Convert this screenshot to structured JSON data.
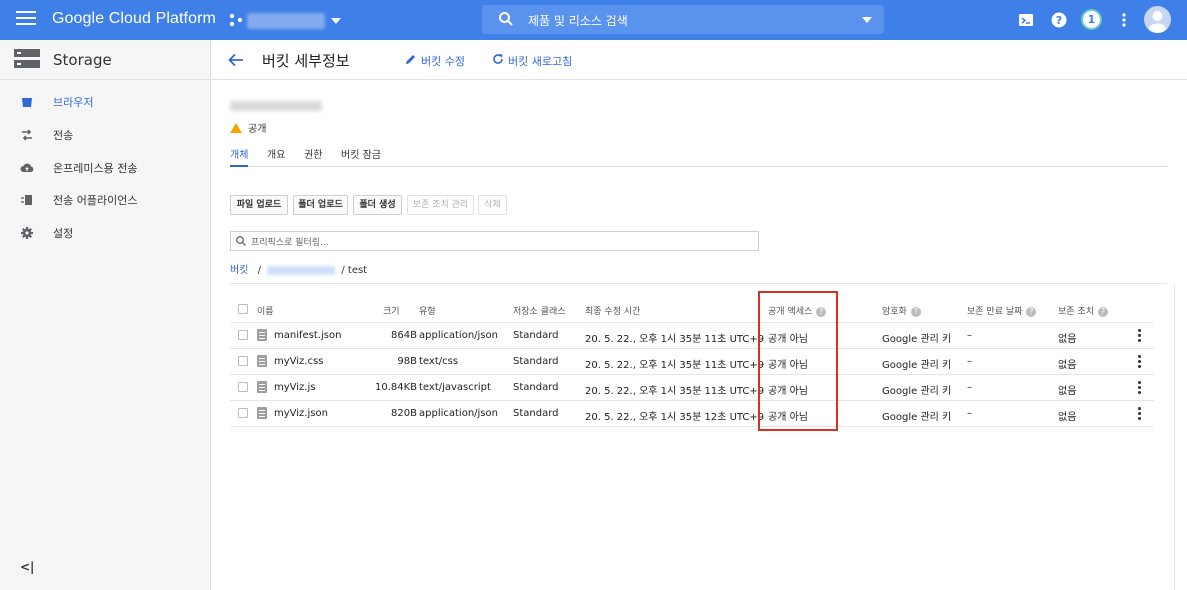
{
  "topbar": {
    "brand": "Google Cloud Platform",
    "search_placeholder": "제품 및 리소스 검색",
    "notification_count": "1"
  },
  "sidebar": {
    "title": "Storage",
    "items": [
      {
        "label": "브라우저",
        "icon": "bucket-icon",
        "active": true
      },
      {
        "label": "전송",
        "icon": "transfer-icon",
        "active": false
      },
      {
        "label": "온프레미스용 전송",
        "icon": "cloud-upload-icon",
        "active": false
      },
      {
        "label": "전송 어플라이언스",
        "icon": "appliance-icon",
        "active": false
      },
      {
        "label": "설정",
        "icon": "gear-icon",
        "active": false
      }
    ],
    "collapse_label": "<|"
  },
  "header": {
    "title": "버킷 세부정보",
    "edit_label": "버킷 수정",
    "refresh_label": "버킷 새로고침"
  },
  "bucket": {
    "access_label": "공개"
  },
  "tabs": [
    "개체",
    "개요",
    "권한",
    "버킷 잠금"
  ],
  "buttons": {
    "upload_files": "파일 업로드",
    "upload_folder": "폴더 업로드",
    "create_folder": "폴더 생성",
    "manage_holds": "보존 조치 관리",
    "delete": "삭제"
  },
  "filter": {
    "placeholder": "프리픽스로 필터링..."
  },
  "breadcrumb": {
    "root": "버킷",
    "sep": "/",
    "folder": "/ test"
  },
  "table": {
    "headers": {
      "name": "이름",
      "size": "크기",
      "type": "유형",
      "storage_class": "저장소 클래스",
      "modified": "최종 수정 시간",
      "public_access": "공개 액세스",
      "encryption": "암호화",
      "retention_expiry": "보존 만료 날짜",
      "hold": "보존 조치"
    },
    "rows": [
      {
        "name": "manifest.json",
        "size": "864B",
        "type": "application/json",
        "storage_class": "Standard",
        "modified": "20. 5. 22., 오후 1시 35분 11초 UTC+9",
        "public_access": "공개 아님",
        "encryption": "Google 관리 키",
        "retention_expiry": "–",
        "hold": "없음"
      },
      {
        "name": "myViz.css",
        "size": "98B",
        "type": "text/css",
        "storage_class": "Standard",
        "modified": "20. 5. 22., 오후 1시 35분 11초 UTC+9",
        "public_access": "공개 아님",
        "encryption": "Google 관리 키",
        "retention_expiry": "–",
        "hold": "없음"
      },
      {
        "name": "myViz.js",
        "size": "10.84KB",
        "type": "text/javascript",
        "storage_class": "Standard",
        "modified": "20. 5. 22., 오후 1시 35분 11초 UTC+9",
        "public_access": "공개 아님",
        "encryption": "Google 관리 키",
        "retention_expiry": "–",
        "hold": "없음"
      },
      {
        "name": "myViz.json",
        "size": "820B",
        "type": "application/json",
        "storage_class": "Standard",
        "modified": "20. 5. 22., 오후 1시 35분 12초 UTC+9",
        "public_access": "공개 아님",
        "encryption": "Google 관리 키",
        "retention_expiry": "–",
        "hold": "없음"
      }
    ]
  },
  "colors": {
    "topbar": "#3f7fe8",
    "accent": "#3367d6",
    "highlight": "#d93025",
    "warning": "#f4a300"
  }
}
